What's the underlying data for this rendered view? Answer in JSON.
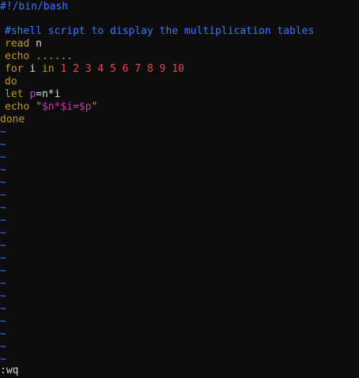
{
  "editor": {
    "shebang": "#!/bin/bash",
    "comment": "#shell script to display the multiplication tables",
    "read_kw": "read",
    "read_arg": "n",
    "echo1_kw": "echo",
    "echo1_arg": "......",
    "for_kw": "for",
    "for_var": "i",
    "in_kw": "in",
    "numbers": "1 2 3 4 5 6 7 8 9 10",
    "do_kw": "do",
    "let_kw": "let",
    "let_var": "p",
    "let_expr": "=n*i",
    "echo2_kw": "echo",
    "echo2_quote_open": "\"",
    "echo2_str": "$n*$i=$p",
    "echo2_quote_close": "\"",
    "done_kw": "done",
    "tilde": "~"
  },
  "command_line": ":wq",
  "colors": {
    "background": "#0c0c0c",
    "comment": "#3b78ff",
    "keyword": "#c19c00",
    "number": "#e74856",
    "variable": "#c239b3",
    "text": "#d6d6d6"
  }
}
